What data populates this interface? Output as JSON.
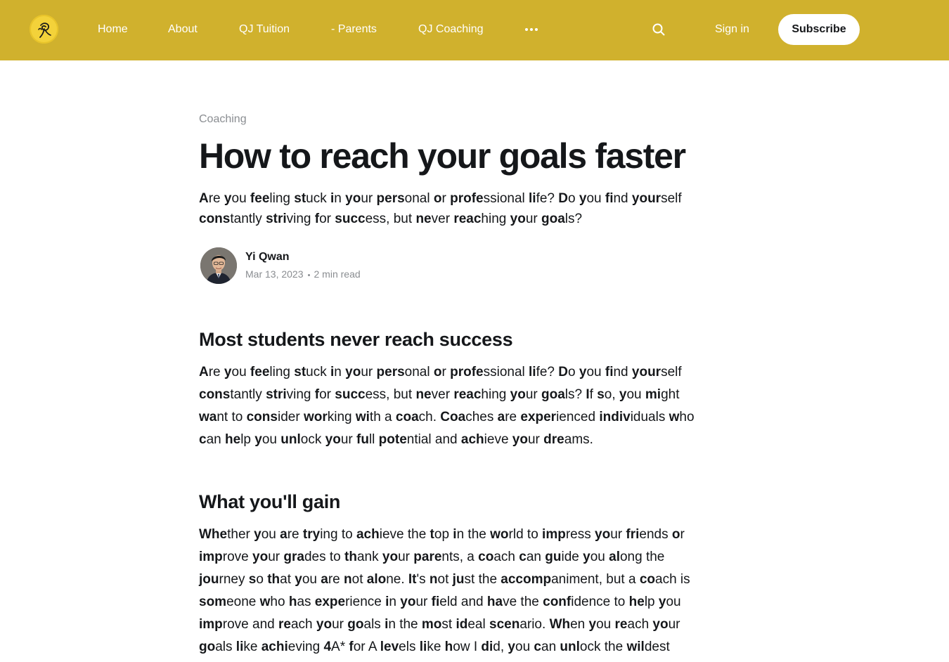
{
  "brand": {
    "accent": "#d0b12d",
    "logo_icon": "qj-logo-icon"
  },
  "nav": {
    "links": [
      "Home",
      "About",
      "QJ Tuition",
      "- Parents",
      "QJ Coaching"
    ],
    "more_icon": "more-dots-icon",
    "search_icon": "search-icon",
    "sign_in": "Sign in",
    "subscribe": "Subscribe"
  },
  "article": {
    "tag": "Coaching",
    "title": "How to reach your goals faster",
    "excerpt": "**A**re **y**ou **fee**ling **st**uck **i**n **yo**ur **pers**onal **o**r **profe**ssional **li**fe? **D**o **y**ou **fi**nd **your**self **cons**tantly **stri**ving **f**or **succ**ess, but **ne**ver **reac**hing **yo**ur **goa**ls?",
    "author": {
      "name": "Yi Qwan",
      "avatar_icon": "avatar",
      "date": "Mar 13, 2023",
      "read_time": "2 min read"
    },
    "sections": [
      {
        "heading": "Most students never reach success",
        "body": "**A**re **y**ou **fee**ling **st**uck **i**n **yo**ur **pers**onal **o**r **profe**ssional **li**fe? **D**o **y**ou **fi**nd **your**self **cons**tantly **stri**ving **f**or **succ**ess, but **ne**ver **reac**hing **yo**ur **goa**ls? **I**f **s**o, **y**ou **mi**ght **wa**nt to **cons**ider **wor**king **wi**th a **coa**ch. **Coa**ches **a**re **exper**ienced **indiv**iduals **w**ho **c**an **he**lp **y**ou **unl**ock **yo**ur **fu**ll **pote**ntial and **ach**ieve **yo**ur **dre**ams."
      },
      {
        "heading": "What you'll gain",
        "body": "**Whe**ther **y**ou **a**re **try**ing to **ach**ieve the **t**op **i**n the **wo**rld to **imp**ress **yo**ur **fri**ends **o**r **imp**rove **yo**ur **gra**des to **th**ank **yo**ur **pare**nts, a **co**ach **c**an **gu**ide **y**ou **al**ong the **jou**rney **s**o **th**at **y**ou **a**re **n**ot **alo**ne. **It**'s **n**ot **ju**st the **accomp**animent, but a **co**ach is **som**eone **w**ho **h**as **expe**rience **i**n **yo**ur **fi**eld and **ha**ve the **conf**idence to **he**lp **y**ou **imp**rove and **re**ach **yo**ur **go**als **i**n the **mo**st **id**eal **scen**ario. **Wh**en **y**ou **re**ach **yo**ur **go**als **li**ke **achi**eving **4**A* **f**or A **lev**els **li**ke **h**ow I **di**d, **y**ou **c**an **unl**ock the **wil**dest"
      }
    ]
  }
}
